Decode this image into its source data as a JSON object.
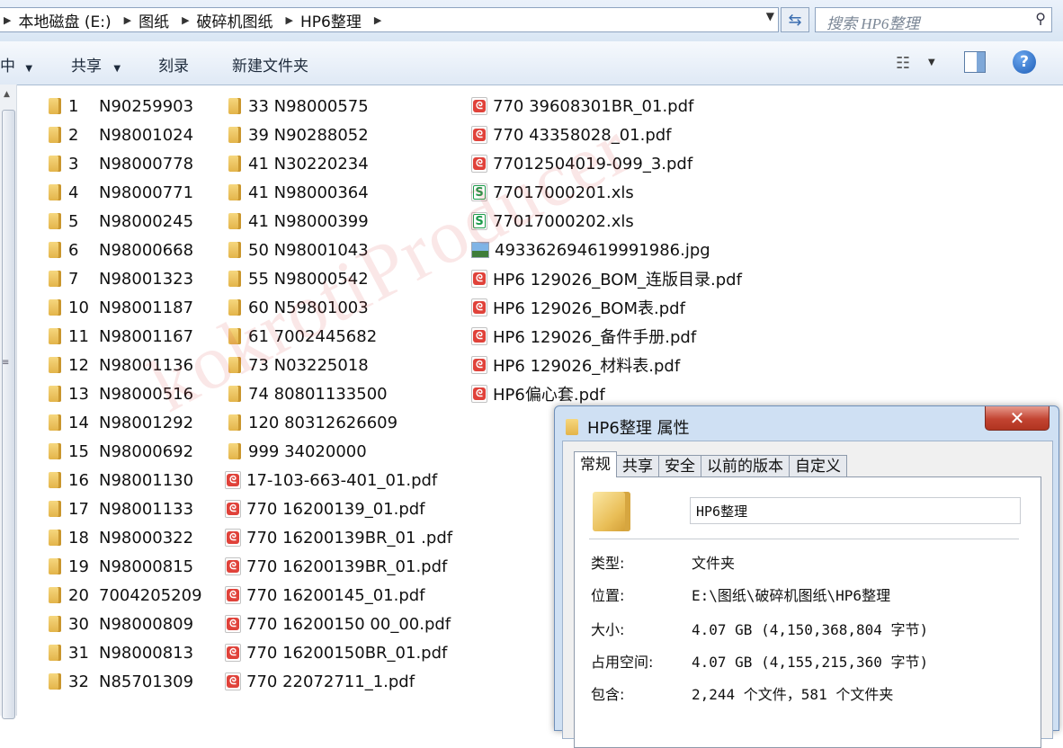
{
  "address": {
    "crumbs": [
      "本地磁盘 (E:)",
      "图纸",
      "破碎机图纸",
      "HP6整理"
    ],
    "search_placeholder": "搜索 HP6整理"
  },
  "toolbar": {
    "organize_partial": "中",
    "share": "共享",
    "burn": "刻录",
    "new_folder": "新建文件夹",
    "help": "?"
  },
  "files": {
    "col1": [
      {
        "num": "1",
        "name": "N90259903"
      },
      {
        "num": "2",
        "name": "N98001024"
      },
      {
        "num": "3",
        "name": "N98000778"
      },
      {
        "num": "4",
        "name": "N98000771"
      },
      {
        "num": "5",
        "name": "N98000245"
      },
      {
        "num": "6",
        "name": "N98000668"
      },
      {
        "num": "7",
        "name": "N98001323"
      },
      {
        "num": "10",
        "name": "N98001187"
      },
      {
        "num": "11",
        "name": "N98001167"
      },
      {
        "num": "12",
        "name": "N98001136"
      },
      {
        "num": "13",
        "name": "N98000516"
      },
      {
        "num": "14",
        "name": "N98001292"
      },
      {
        "num": "15",
        "name": "N98000692"
      },
      {
        "num": "16",
        "name": "N98001130"
      },
      {
        "num": "17",
        "name": "N98001133"
      },
      {
        "num": "18",
        "name": "N98000322"
      },
      {
        "num": "19",
        "name": "N98000815"
      },
      {
        "num": "20",
        "name": "7004205209"
      },
      {
        "num": "30",
        "name": "N98000809"
      },
      {
        "num": "31",
        "name": "N98000813"
      },
      {
        "num": "32",
        "name": "N85701309"
      }
    ],
    "col2": [
      {
        "type": "folder",
        "name": "33  N98000575"
      },
      {
        "type": "folder",
        "name": "39  N90288052"
      },
      {
        "type": "folder",
        "name": "41  N30220234"
      },
      {
        "type": "folder",
        "name": "41  N98000364"
      },
      {
        "type": "folder",
        "name": "41  N98000399"
      },
      {
        "type": "folder",
        "name": "50  N98001043"
      },
      {
        "type": "folder",
        "name": "55  N98000542"
      },
      {
        "type": "folder",
        "name": "60  N59801003"
      },
      {
        "type": "folder",
        "name": "61  7002445682"
      },
      {
        "type": "folder",
        "name": "73  N03225018"
      },
      {
        "type": "folder",
        "name": "74  80801133500"
      },
      {
        "type": "folder",
        "name": "120 80312626609"
      },
      {
        "type": "folder",
        "name": "999 34020000"
      },
      {
        "type": "pdf",
        "name": "17-103-663-401_01.pdf"
      },
      {
        "type": "pdf",
        "name": "770 16200139_01.pdf"
      },
      {
        "type": "pdf",
        "name": "770 16200139BR_01 .pdf"
      },
      {
        "type": "pdf",
        "name": "770 16200139BR_01.pdf"
      },
      {
        "type": "pdf",
        "name": "770 16200145_01.pdf"
      },
      {
        "type": "pdf",
        "name": "770 16200150 00_00.pdf"
      },
      {
        "type": "pdf",
        "name": "770 16200150BR_01.pdf"
      },
      {
        "type": "pdf",
        "name": "770 22072711_1.pdf"
      }
    ],
    "col3": [
      {
        "type": "pdf",
        "name": "770 39608301BR_01.pdf"
      },
      {
        "type": "pdf",
        "name": "770 43358028_01.pdf"
      },
      {
        "type": "pdf",
        "name": "77012504019-099_3.pdf"
      },
      {
        "type": "xls",
        "name": "77017000201.xls"
      },
      {
        "type": "xls",
        "name": "77017000202.xls"
      },
      {
        "type": "jpg",
        "name": "493362694619991986.jpg"
      },
      {
        "type": "pdf",
        "name": "HP6 129026_BOM_连版目录.pdf"
      },
      {
        "type": "pdf",
        "name": "HP6 129026_BOM表.pdf"
      },
      {
        "type": "pdf",
        "name": "HP6 129026_备件手册.pdf"
      },
      {
        "type": "pdf",
        "name": "HP6 129026_材料表.pdf"
      },
      {
        "type": "pdf",
        "name": "HP6偏心套.pdf"
      }
    ]
  },
  "watermark": "kokrotiProducer",
  "dialog": {
    "title": "HP6整理 属性",
    "close": "✕",
    "tabs": [
      "常规",
      "共享",
      "安全",
      "以前的版本",
      "自定义"
    ],
    "name_value": "HP6整理",
    "props": [
      {
        "label": "类型:",
        "value": "文件夹"
      },
      {
        "label": "位置:",
        "value": "E:\\图纸\\破碎机图纸\\HP6整理"
      },
      {
        "label": "大小:",
        "value": "4.07 GB (4,150,368,804 字节)"
      },
      {
        "label": "占用空间:",
        "value": "4.07 GB (4,155,215,360 字节)"
      },
      {
        "label": "包含:",
        "value": "2,244 个文件，581 个文件夹"
      }
    ]
  }
}
